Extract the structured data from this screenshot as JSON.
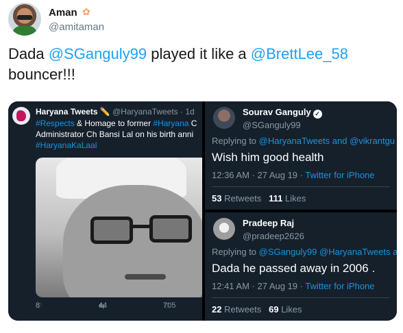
{
  "author": {
    "name": "Aman",
    "handle": "@amitaman",
    "flag_icon": "lotus-icon"
  },
  "tweet": {
    "text_1": "Dada ",
    "mention_1": "@SGanguly99",
    "text_2": " played it like a ",
    "mention_2": "@BrettLee_58",
    "text_3": "bouncer!!!"
  },
  "embedded": {
    "haryana": {
      "name": "Haryana Tweets ✏️",
      "handle_time": "@HaryanaTweets · 1d",
      "line1_tag": "#Respects",
      "line1_text": " & Homage to former ",
      "line1_tag2": "#Haryana",
      "line1_tail": " C",
      "line2": "Administrator Ch Bansi Lal on his birth anni",
      "line3_tag": "#HaryanaKaLaal",
      "replies": "8",
      "retweets": "44",
      "likes": "705"
    },
    "ganguly": {
      "name": "Sourav Ganguly",
      "handle": "@SGanguly99",
      "replying_label": "Replying to ",
      "replying_to": "@HaryanaTweets and @vikrantgu",
      "text": "Wish him good health",
      "time": "12:36 AM · 27 Aug 19 · ",
      "client": "Twitter for iPhone",
      "retweets_count": "53",
      "retweets_label": " Retweets",
      "likes_count": "111",
      "likes_label": " Likes"
    },
    "pradeep": {
      "name": "Pradeep Raj",
      "handle": "@pradeep2626",
      "replying_label": "Replying to ",
      "replying_to": "@SGanguly99 @HaryanaTweets a",
      "text": "Dada he passed away in 2006 .",
      "time": "12:41 AM · 27 Aug 19 · ",
      "client": "Twitter for iPhone",
      "retweets_count": "22",
      "retweets_label": " Retweets",
      "likes_count": "69",
      "likes_label": " Likes"
    }
  },
  "colors": {
    "link": "#1da1f2",
    "dark_bg": "#15202b",
    "dim_text": "#8899a6"
  }
}
